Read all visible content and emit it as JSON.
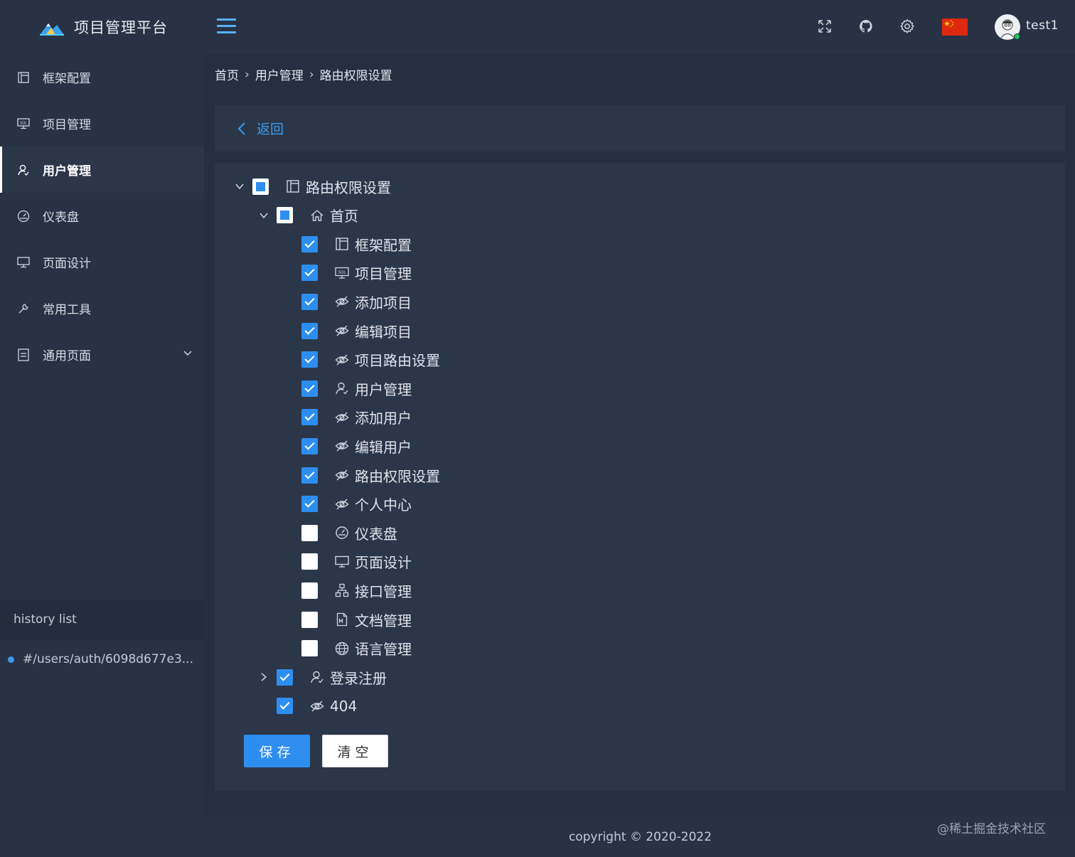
{
  "app": {
    "title": "项目管理平台"
  },
  "sidebar": {
    "items": [
      {
        "label": "框架配置",
        "icon": "layout-icon"
      },
      {
        "label": "项目管理",
        "icon": "sql-monitor-icon"
      },
      {
        "label": "用户管理",
        "icon": "user-icon",
        "active": true
      },
      {
        "label": "仪表盘",
        "icon": "dashboard-icon"
      },
      {
        "label": "页面设计",
        "icon": "desktop-icon"
      },
      {
        "label": "常用工具",
        "icon": "tool-icon"
      },
      {
        "label": "通用页面",
        "icon": "page-icon",
        "expandable": true
      }
    ],
    "history_title": "history list",
    "history_items": [
      "#/users/auth/6098d677e3..."
    ]
  },
  "header": {
    "icons": [
      "fullscreen-icon",
      "github-icon",
      "settings-icon",
      "china-flag-icon"
    ],
    "username": "test1"
  },
  "breadcrumb": [
    "首页",
    "用户管理",
    "路由权限设置"
  ],
  "back": {
    "label": "返回"
  },
  "tree": [
    {
      "label": "路由权限设置",
      "icon": "layout-icon",
      "level": 0,
      "state": "partial",
      "caret": "down"
    },
    {
      "label": "首页",
      "icon": "home-icon",
      "level": 1,
      "state": "partial",
      "caret": "down"
    },
    {
      "label": "框架配置",
      "icon": "layout-icon",
      "level": 2,
      "state": "checked"
    },
    {
      "label": "项目管理",
      "icon": "sql-monitor-icon",
      "level": 2,
      "state": "checked"
    },
    {
      "label": "添加项目",
      "icon": "eye-off-icon",
      "level": 2,
      "state": "checked"
    },
    {
      "label": "编辑项目",
      "icon": "eye-off-icon",
      "level": 2,
      "state": "checked"
    },
    {
      "label": "项目路由设置",
      "icon": "eye-off-icon",
      "level": 2,
      "state": "checked"
    },
    {
      "label": "用户管理",
      "icon": "user-icon",
      "level": 2,
      "state": "checked"
    },
    {
      "label": "添加用户",
      "icon": "eye-off-icon",
      "level": 2,
      "state": "checked"
    },
    {
      "label": "编辑用户",
      "icon": "eye-off-icon",
      "level": 2,
      "state": "checked"
    },
    {
      "label": "路由权限设置",
      "icon": "eye-off-icon",
      "level": 2,
      "state": "checked"
    },
    {
      "label": "个人中心",
      "icon": "eye-off-icon",
      "level": 2,
      "state": "checked"
    },
    {
      "label": "仪表盘",
      "icon": "dashboard-icon",
      "level": 2,
      "state": "unchecked"
    },
    {
      "label": "页面设计",
      "icon": "desktop-icon",
      "level": 2,
      "state": "unchecked"
    },
    {
      "label": "接口管理",
      "icon": "api-icon",
      "level": 2,
      "state": "unchecked"
    },
    {
      "label": "文档管理",
      "icon": "markdown-file-icon",
      "level": 2,
      "state": "unchecked"
    },
    {
      "label": "语言管理",
      "icon": "globe-icon",
      "level": 2,
      "state": "unchecked"
    },
    {
      "label": "登录注册",
      "icon": "user-icon",
      "level": 1,
      "state": "checked",
      "caret": "right"
    },
    {
      "label": "404",
      "icon": "eye-off-icon",
      "level": 1,
      "state": "checked"
    }
  ],
  "actions": {
    "save": "保存",
    "clear": "清空"
  },
  "footer": {
    "copyright": "copyright © 2020-2022",
    "watermark": "@稀土掘金技术社区"
  },
  "colors": {
    "accent": "#2e8ef0",
    "sidebar_bg": "#283244",
    "panel_bg": "#2c3649",
    "page_bg": "#262f40"
  }
}
